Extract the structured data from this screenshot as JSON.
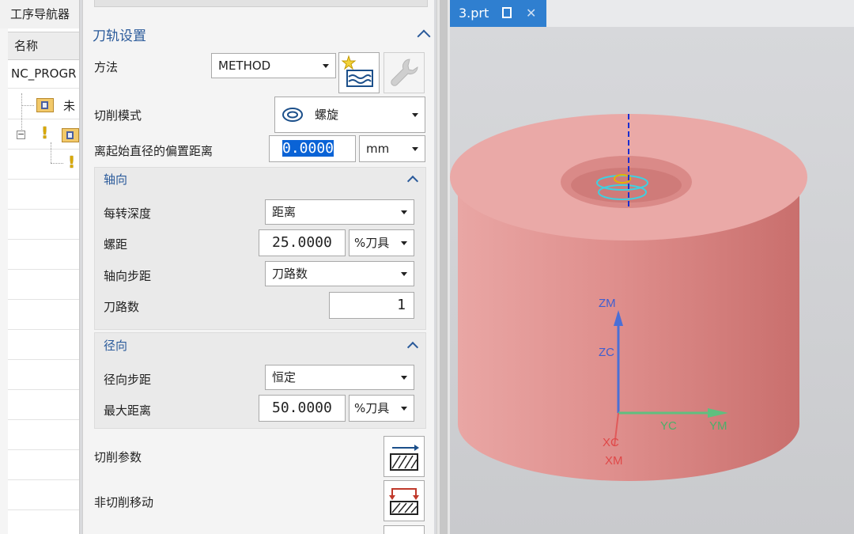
{
  "navigator": {
    "title": "工序导航器",
    "column_header": "名称",
    "root_item": "NC_PROGR",
    "child_item": "未"
  },
  "dialog": {
    "section_title": "刀轨设置",
    "method": {
      "label": "方法",
      "value": "METHOD"
    },
    "cut_mode": {
      "label": "切削模式",
      "value": "螺旋"
    },
    "offset": {
      "label": "离起始直径的偏置距离",
      "value": "0.0000",
      "unit": "mm"
    },
    "axial": {
      "title": "轴向",
      "depth_per_rev": {
        "label": "每转深度",
        "value": "距离"
      },
      "pitch": {
        "label": "螺距",
        "value": "25.0000",
        "unit": "%刀具"
      },
      "axial_step": {
        "label": "轴向步距",
        "value": "刀路数"
      },
      "passes": {
        "label": "刀路数",
        "value": "1"
      }
    },
    "radial": {
      "title": "径向",
      "radial_step": {
        "label": "径向步距",
        "value": "恒定"
      },
      "max_distance": {
        "label": "最大距离",
        "value": "50.0000",
        "unit": "%刀具"
      }
    },
    "cut_params": {
      "label": "切削参数"
    },
    "non_cut_moves": {
      "label": "非切削移动"
    }
  },
  "tab": {
    "filename": "3.prt"
  },
  "viewport": {
    "axes": {
      "zm": "ZM",
      "zc": "ZC",
      "xc": "XC",
      "xm": "XM",
      "yc": "YC",
      "ym": "YM"
    },
    "part_color": "#e99a98",
    "axis_colors": {
      "z": "#4a6fd6",
      "y": "#5fbf7f",
      "x": "#e05a5a"
    }
  }
}
